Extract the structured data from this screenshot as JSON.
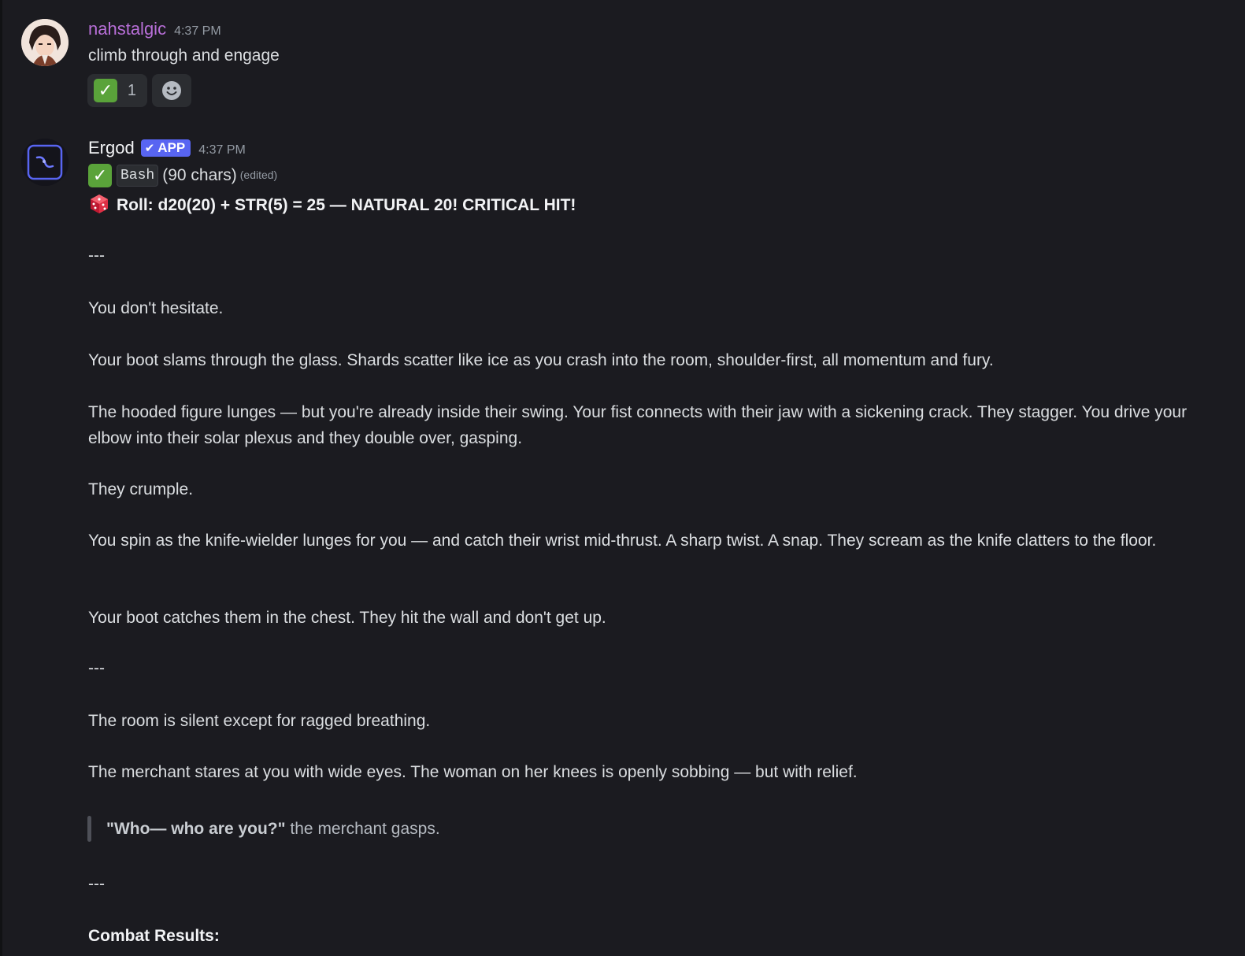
{
  "message1": {
    "username": "nahstalgic",
    "timestamp": "4:37 PM",
    "content": "climb through and engage",
    "reaction_count": "1"
  },
  "message2": {
    "username": "Ergod",
    "badge": "APP",
    "timestamp": "4:37 PM",
    "code_label": "Bash",
    "chars_text": "(90 chars)",
    "edited": "(edited)",
    "roll": "Roll: d20(20) + STR(5) = 25 — NATURAL 20! CRITICAL HIT!",
    "sep1": "---",
    "p1": "You don't hesitate.",
    "p2": "Your boot slams through the glass. Shards scatter like ice as you crash into the room, shoulder-first, all momentum and fury.",
    "p3": "The hooded figure lunges — but you're already inside their swing. Your fist connects with their jaw with a sickening crack. They stagger. You drive your elbow into their solar plexus and they double over, gasping.",
    "p4": "They crumple.",
    "p5": "You spin as the knife-wielder lunges for you — and catch their wrist mid-thrust. A sharp twist. A snap. They scream as the knife clatters to the floor.",
    "p6": "Your boot catches them in the chest. They hit the wall and don't get up.",
    "sep2": "---",
    "p7": "The room is silent except for ragged breathing.",
    "p8": "The merchant stares at you with wide eyes. The woman on her knees is openly sobbing — but with relief.",
    "quote_bold": "\"Who— who are you?\"",
    "quote_rest": " the merchant gasps.",
    "sep3": "---",
    "combat_heading": "Combat Results:"
  },
  "colors": {
    "username1": "#b86fd8",
    "username2": "#f2f3f5",
    "badge": "#5865f2",
    "check": "#5aa33a"
  }
}
